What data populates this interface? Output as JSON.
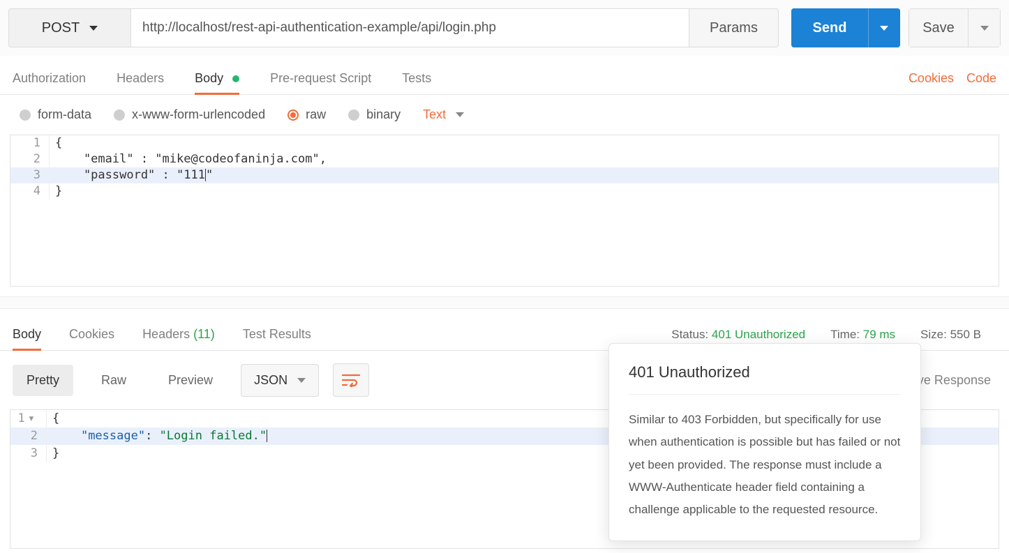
{
  "topbar": {
    "method": "POST",
    "url": "http://localhost/rest-api-authentication-example/api/login.php",
    "params_label": "Params",
    "send_label": "Send",
    "save_label": "Save"
  },
  "req_tabs": {
    "authorization": "Authorization",
    "headers": "Headers",
    "body": "Body",
    "prerequest": "Pre-request Script",
    "tests": "Tests",
    "cookies_link": "Cookies",
    "code_link": "Code"
  },
  "bodymode": {
    "formdata": "form-data",
    "urlencoded": "x-www-form-urlencoded",
    "raw": "raw",
    "binary": "binary",
    "text_dd": "Text"
  },
  "request_body": {
    "l1": "{",
    "l2": "    \"email\" : \"mike@codeofaninja.com\",",
    "l3": "    \"password\" : \"111",
    "l3b": "\"",
    "l4": "}"
  },
  "resp_tabs": {
    "body": "Body",
    "cookies": "Cookies",
    "headers": "Headers",
    "headers_count": "(11)",
    "tests": "Test Results"
  },
  "resp_meta": {
    "status_label": "Status:",
    "status_value": "401 Unauthorized",
    "time_label": "Time:",
    "time_value": "79 ms",
    "size_label": "Size:",
    "size_value": "550 B"
  },
  "resp_toolbar": {
    "pretty": "Pretty",
    "raw": "Raw",
    "preview": "Preview",
    "json": "JSON",
    "save_response": "Save Response"
  },
  "response_body": {
    "l1": "{",
    "l2_key": "\"message\"",
    "l2_colon": ": ",
    "l2_val": "\"Login failed.\"",
    "l3": "}"
  },
  "tooltip": {
    "title": "401 Unauthorized",
    "text": "Similar to 403 Forbidden, but specifically for use when authentication is possible but has failed or not yet been provided. The response must include a WWW-Authenticate header field containing a challenge applicable to the requested resource."
  }
}
